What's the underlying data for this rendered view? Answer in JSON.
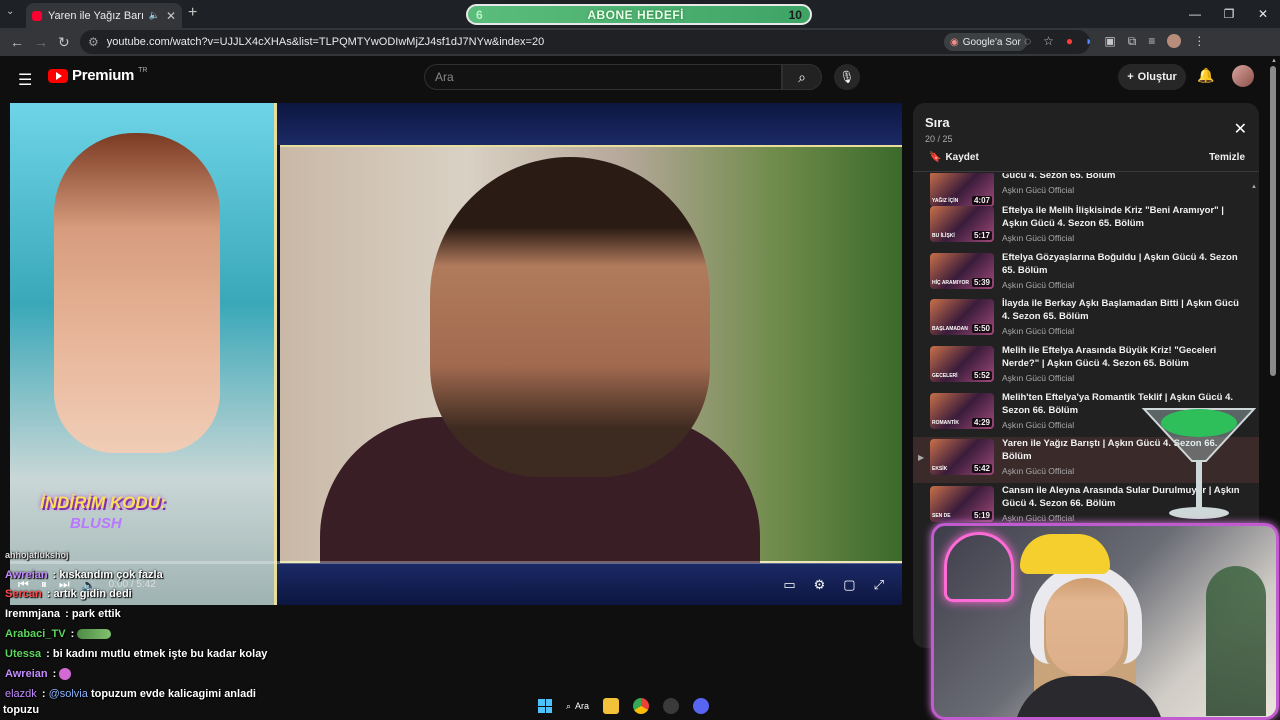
{
  "browser": {
    "tab_title": "Yaren ile Yağız Barıştı | Aşkın",
    "url": "youtube.com/watch?v=UJJLX4cXHAs&list=TLPQMTYwODIwMjZJ4sf1dJ7NYw&index=20",
    "google_sor": "Google'a Sor"
  },
  "goal_overlay": {
    "left": "6",
    "label": "ABONE HEDEFİ",
    "right": "10"
  },
  "youtube": {
    "logo_text": "Premium",
    "country": "TR",
    "search_placeholder": "Ara",
    "create_label": "Oluştur"
  },
  "player": {
    "time": "0:00 / 5:42",
    "progress": 0.0,
    "promo_line1": "İNDİRİM KODU:",
    "promo_line2": "BLUSH"
  },
  "chat": [
    {
      "user": "ahhojaflukshoj",
      "msg": "",
      "color": "#ffffff"
    },
    {
      "user": "Awreian",
      "msg": "kıskandım çok fazla",
      "color": "#c48cff"
    },
    {
      "user": "Sercan",
      "msg": "artık gidin dedi",
      "color": "#ff4b4b"
    },
    {
      "user": "Iremmjana",
      "msg": "park ettik",
      "color": "#ffffff"
    },
    {
      "user": "Arabaci_TV",
      "msg": "",
      "color": "#5cd65c"
    },
    {
      "user": "Utessa",
      "msg": "bi kadını mutlu etmek işte bu kadar kolay",
      "color": "#5cd65c"
    },
    {
      "user": "Awreian",
      "msg": "",
      "color": "#c48cff"
    },
    {
      "user": "elazdk",
      "msg": "topuzum evde kalicagimi anladi",
      "mention": "@solvia",
      "color": "#c48cff"
    },
    {
      "user": "",
      "msg": "topuzu",
      "color": "#ffffff"
    }
  ],
  "queue": {
    "title": "Sıra",
    "count": "20 / 25",
    "save_label": "Kaydet",
    "clear_label": "Temizle",
    "items": [
      {
        "title": "Gücü 4. Sezon 65. Bölüm",
        "channel": "Aşkın Gücü Official",
        "duration": "4:07",
        "caption": "YAĞIZ İÇİN"
      },
      {
        "title": "Eftelya ile Melih İlişkisinde Kriz \"Beni Aramıyor\" | Aşkın Gücü 4. Sezon 65. Bölüm",
        "channel": "Aşkın Gücü Official",
        "duration": "5:17",
        "caption": "BU İLİŞKİ"
      },
      {
        "title": "Eftelya Gözyaşlarına Boğuldu | Aşkın Gücü 4. Sezon 65. Bölüm",
        "channel": "Aşkın Gücü Official",
        "duration": "5:39",
        "caption": "HİÇ ARAMIYOR"
      },
      {
        "title": "İlayda ile Berkay Aşkı Başlamadan Bitti | Aşkın Gücü 4. Sezon 65. Bölüm",
        "channel": "Aşkın Gücü Official",
        "duration": "5:50",
        "caption": "BAŞLAMADAN"
      },
      {
        "title": "Melih ile Eftelya Arasında Büyük Kriz! \"Geceleri Nerde?\" | Aşkın Gücü 4. Sezon 65. Bölüm",
        "channel": "Aşkın Gücü Official",
        "duration": "5:52",
        "caption": "GECELERİ"
      },
      {
        "title": "Melih'ten Eftelya'ya Romantik Teklif | Aşkın Gücü 4. Sezon 66. Bölüm",
        "channel": "Aşkın Gücü Official",
        "duration": "4:29",
        "caption": "ROMANTİK"
      },
      {
        "title": "Yaren ile Yağız Barıştı | Aşkın Gücü 4. Sezon 66. Bölüm",
        "channel": "Aşkın Gücü Official",
        "duration": "5:42",
        "caption": "EKSİK",
        "active": true
      },
      {
        "title": "Cansın ile Aleyna Arasında Sular Durulmuyor | Aşkın Gücü 4. Sezon 66. Bölüm",
        "channel": "Aşkın Gücü Official",
        "duration": "5:19",
        "caption": "SEN DE"
      }
    ]
  },
  "taskbar": {
    "search_label": "Ara"
  }
}
